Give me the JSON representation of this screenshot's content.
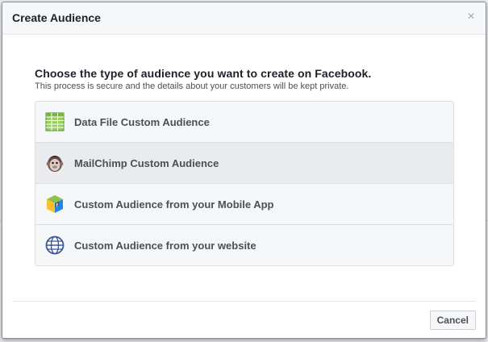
{
  "dialog": {
    "title": "Create Audience",
    "close_glyph": "×",
    "heading": "Choose the type of audience you want to create on Facebook.",
    "subtext": "This process is secure and the details about your customers will be kept private.",
    "options": [
      {
        "label": "Data File Custom Audience",
        "icon": "spreadsheet-icon"
      },
      {
        "label": "MailChimp Custom Audience",
        "icon": "mailchimp-icon"
      },
      {
        "label": "Custom Audience from your Mobile App",
        "icon": "mobile-app-cube-icon"
      },
      {
        "label": "Custom Audience from your website",
        "icon": "globe-icon"
      }
    ],
    "cancel_label": "Cancel"
  },
  "colors": {
    "header_bg": "#f6f7f9",
    "option_bg": "#f6f7f9",
    "option_hover_bg": "#e9ebee",
    "text_dark": "#1d2129",
    "text_muted": "#4b4f56"
  }
}
